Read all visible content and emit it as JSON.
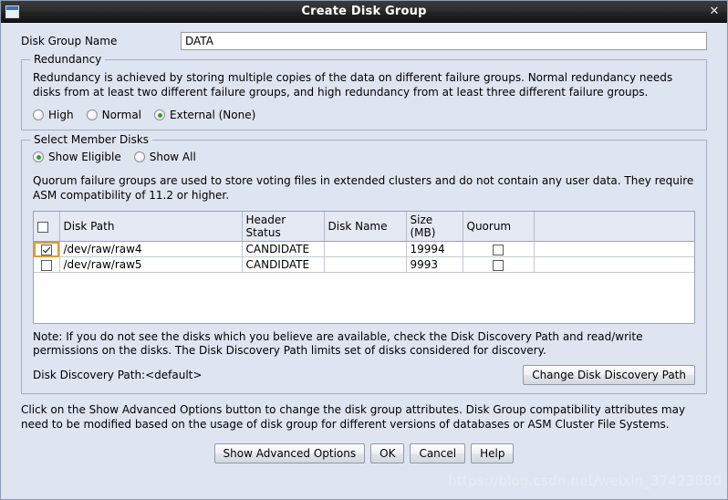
{
  "window": {
    "title": "Create Disk Group",
    "close_label": "✕",
    "icon": "window-icon"
  },
  "disk_group_name": {
    "label": "Disk Group Name",
    "value": "DATA",
    "placeholder": ""
  },
  "redundancy": {
    "legend": "Redundancy",
    "description": "Redundancy is achieved by storing multiple copies of the data on different failure groups. Normal redundancy needs disks from at least two different failure groups, and high redundancy from at least three different failure groups.",
    "options": [
      {
        "label": "High",
        "selected": false
      },
      {
        "label": "Normal",
        "selected": false
      },
      {
        "label": "External (None)",
        "selected": true
      }
    ]
  },
  "member_disks": {
    "legend": "Select Member Disks",
    "filter_options": [
      {
        "label": "Show Eligible",
        "selected": true
      },
      {
        "label": "Show All",
        "selected": false
      }
    ],
    "quorum_note": "Quorum failure groups are used to store voting files in extended clusters and do not contain any user data. They require ASM compatibility of 11.2 or higher.",
    "columns": [
      "",
      "Disk Path",
      "Header Status",
      "Disk Name",
      "Size (MB)",
      "Quorum"
    ],
    "header_select_all_checked": false,
    "rows": [
      {
        "selected": true,
        "focused": true,
        "disk_path": "/dev/raw/raw4",
        "header_status": "CANDIDATE",
        "disk_name": "",
        "size_mb": "19994",
        "quorum": false
      },
      {
        "selected": false,
        "focused": false,
        "disk_path": "/dev/raw/raw5",
        "header_status": "CANDIDATE",
        "disk_name": "",
        "size_mb": "9993",
        "quorum": false
      }
    ],
    "note": "Note: If you do not see the disks which you believe are available, check the Disk Discovery Path and read/write permissions on the disks. The Disk Discovery Path limits set of disks considered for discovery.",
    "discovery_path_label": "Disk Discovery Path:<default>",
    "change_discovery_button": "Change Disk Discovery Path"
  },
  "footer": {
    "description": "Click on the Show Advanced Options button to change the disk group attributes. Disk Group compatibility attributes may need to be modified based on the usage of disk group for different versions of databases or ASM Cluster File Systems.",
    "buttons": [
      {
        "label": "Show Advanced Options"
      },
      {
        "label": "OK"
      },
      {
        "label": "Cancel"
      },
      {
        "label": "Help"
      }
    ]
  },
  "watermark": "https://blog.csdn.net/weixin_37423880",
  "colors": {
    "background": "#dfe4f1",
    "titlebar": "#2a2a2a",
    "accent_radio": "#2aa42a",
    "focus_outline": "#d79d3e",
    "table_header": "#e4e9f4"
  }
}
